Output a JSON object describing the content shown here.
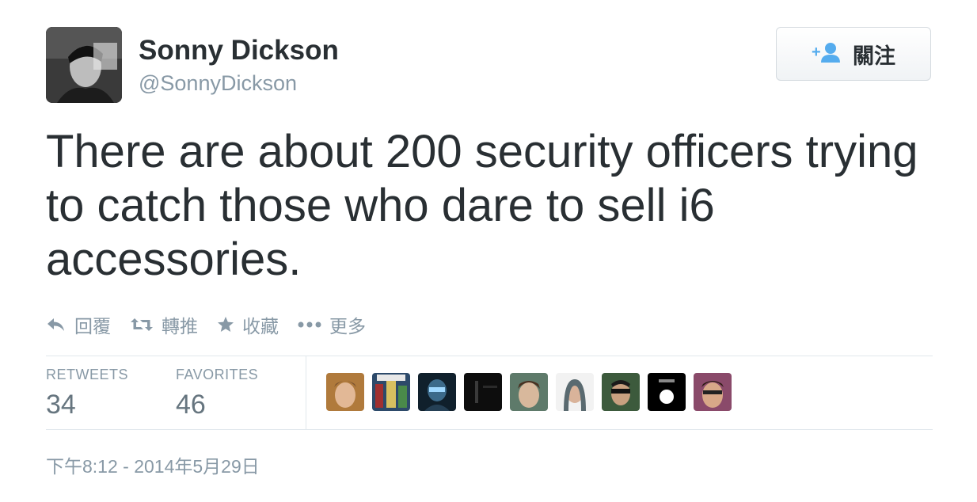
{
  "user": {
    "display_name": "Sonny Dickson",
    "handle": "@SonnyDickson"
  },
  "follow_button": {
    "label": "關注"
  },
  "tweet": {
    "text": "There are about 200 security officers trying to catch those who dare to sell i6 accessories."
  },
  "actions": {
    "reply_label": "回覆",
    "retweet_label": "轉推",
    "favorite_label": "收藏",
    "more_label": "更多"
  },
  "stats": {
    "retweets_label": "RETWEETS",
    "retweets_count": "34",
    "favorites_label": "FAVORITES",
    "favorites_count": "46"
  },
  "timestamp": "下午8:12 - 2014年5月29日",
  "colors": {
    "text": "#292f33",
    "muted": "#8899a6",
    "follow_icon": "#55acee",
    "divider": "#e1e8ed"
  },
  "icons": [
    "follow-person-plus-icon",
    "reply-arrow-icon",
    "retweet-icon",
    "star-icon",
    "ellipsis-icon"
  ]
}
